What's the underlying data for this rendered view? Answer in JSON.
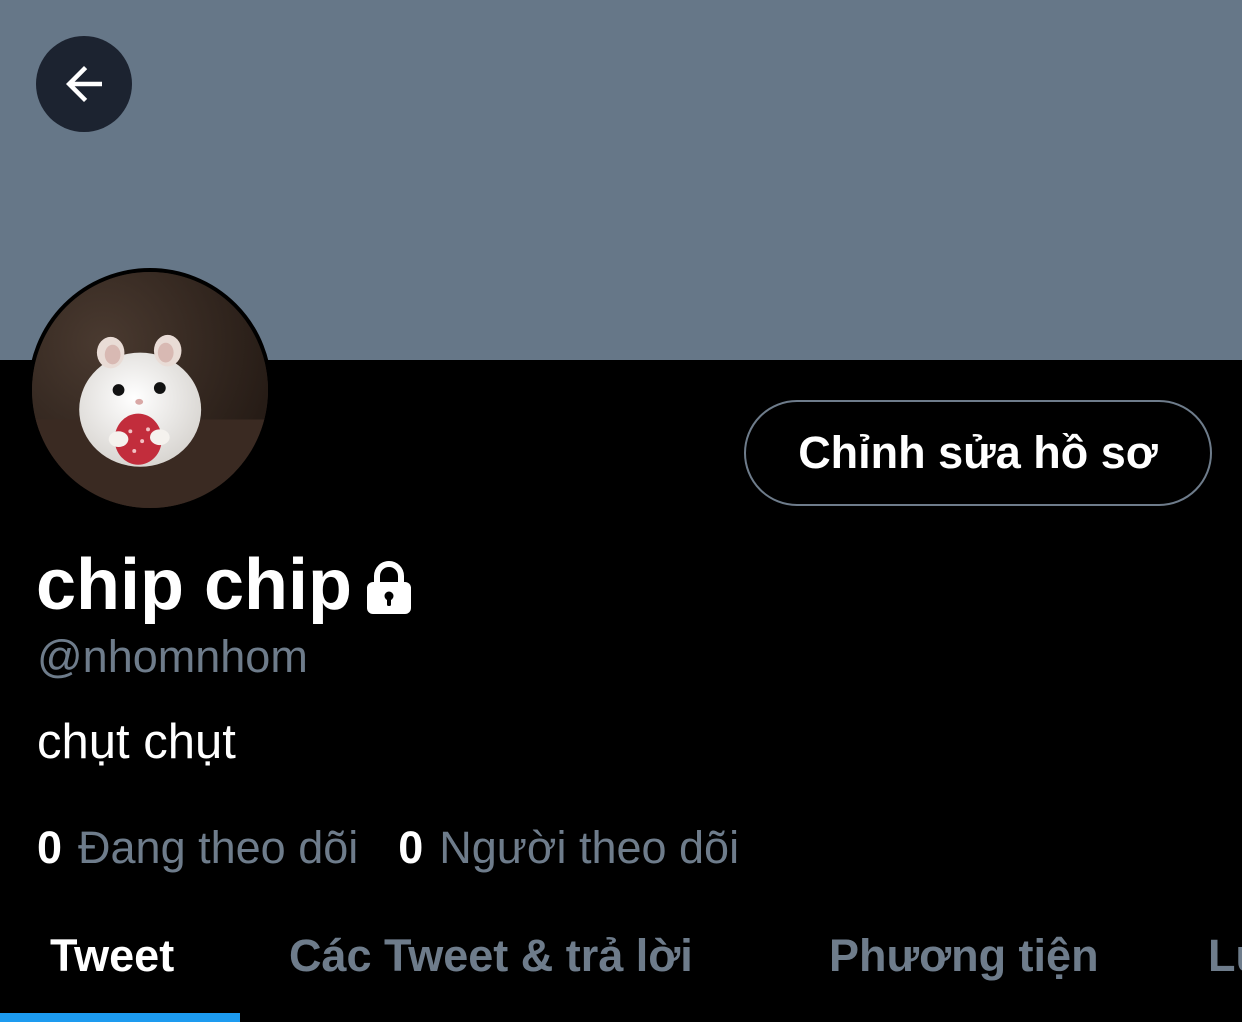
{
  "colors": {
    "banner": "#667788",
    "background": "#000000",
    "secondary_text": "#6e7c8b",
    "accent": "#1d9bf0"
  },
  "header": {
    "back_icon": "arrow-left-icon"
  },
  "profile": {
    "avatar": "hamster-avatar",
    "edit_button_label": "Chỉnh sửa hồ sơ",
    "display_name": "chip chip",
    "protected_icon": "lock-icon",
    "handle": "@nhomnhom",
    "bio": "chụt chụt",
    "following_count": "0",
    "following_label": "Đang theo dõi",
    "followers_count": "0",
    "followers_label": "Người theo dõi"
  },
  "tabs": [
    {
      "label": "Tweet",
      "active": true
    },
    {
      "label": "Các Tweet & trả lời",
      "active": false
    },
    {
      "label": "Phương tiện",
      "active": false
    },
    {
      "label": "Lượt thích",
      "active": false
    }
  ]
}
